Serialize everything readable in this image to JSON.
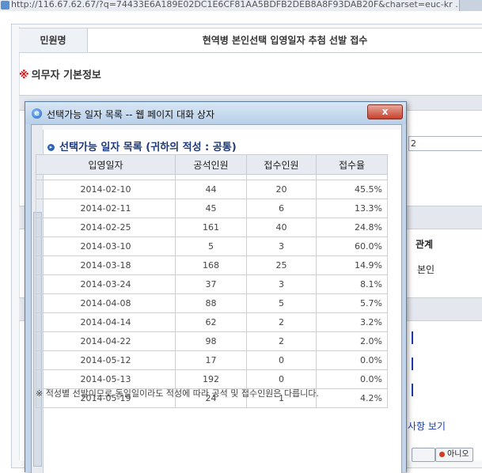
{
  "browser": {
    "address": "http://116.67.62.67/?q=74433E6A189E02DC1E6CF81AA5BDFB2DEB8A8F93DAB20F&charset=euc-kr ..."
  },
  "background": {
    "title_label": "민원명",
    "title_text": "현역병 본인선택 입영일자 추첨 선발 접수",
    "section_marker": "※",
    "section_title": "의무자 기본정보",
    "input_value": "2",
    "relation_header": "관계",
    "relation_value": "본인",
    "view_link": "사항 보기",
    "no_button": "아니오"
  },
  "dialog": {
    "title": "선택가능 일자 목록 -- 웹 페이지 대화 상자",
    "close_label": "x",
    "list_title": "선택가능 일자 목록 (귀하의 적성 : 공통)",
    "columns": [
      "입영일자",
      "공석인원",
      "접수인원",
      "접수율"
    ],
    "rows": [
      [
        "2014-02-10",
        "44",
        "20",
        "45.5%"
      ],
      [
        "2014-02-11",
        "45",
        "6",
        "13.3%"
      ],
      [
        "2014-02-25",
        "161",
        "40",
        "24.8%"
      ],
      [
        "2014-03-10",
        "5",
        "3",
        "60.0%"
      ],
      [
        "2014-03-18",
        "168",
        "25",
        "14.9%"
      ],
      [
        "2014-03-24",
        "37",
        "3",
        "8.1%"
      ],
      [
        "2014-04-08",
        "88",
        "5",
        "5.7%"
      ],
      [
        "2014-04-14",
        "62",
        "2",
        "3.2%"
      ],
      [
        "2014-04-22",
        "98",
        "2",
        "2.0%"
      ],
      [
        "2014-05-12",
        "17",
        "0",
        "0.0%"
      ],
      [
        "2014-05-13",
        "192",
        "0",
        "0.0%"
      ],
      [
        "2014-05-19",
        "24",
        "1",
        "4.2%"
      ]
    ],
    "note": "※ 적성별 선발이므로 동일일이라도 적성에 따라 공석 및 접수인원은 다릅니다."
  }
}
